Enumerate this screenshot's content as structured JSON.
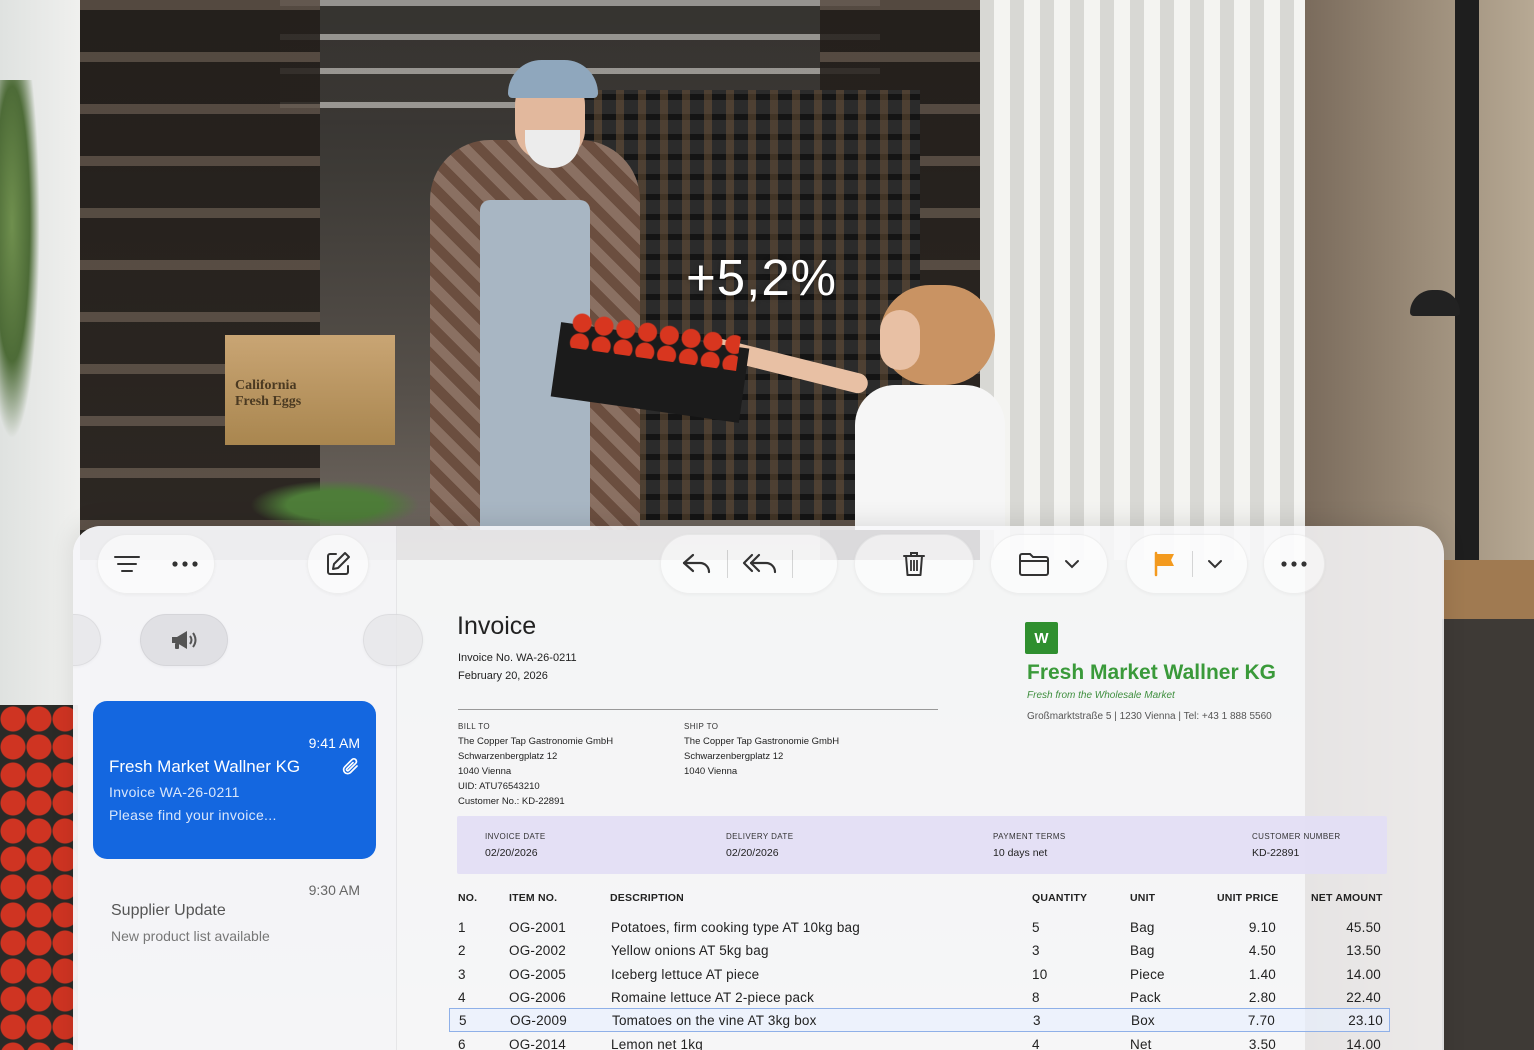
{
  "overlay": {
    "percent": "+5,2%"
  },
  "photo": {
    "box_text_1": "California",
    "box_text_2": "Fresh Eggs"
  },
  "sidebar": {
    "icons": [
      "menu-lines-icon",
      "ellipsis-icon",
      "compose-icon",
      "megaphone-icon"
    ],
    "messages": [
      {
        "time": "9:41 AM",
        "sender": "Fresh Market Wallner KG",
        "subject": "Invoice WA-26-0211",
        "preview": "Please find your invoice...",
        "selected": true
      },
      {
        "time": "9:30 AM",
        "sender": "Supplier Update",
        "preview": "New product list available",
        "selected": false
      }
    ]
  },
  "toolbar": {
    "icons": [
      "reply-icon",
      "reply-all-icon",
      "trash-icon",
      "folder-icon",
      "chevron-down-icon",
      "flag-icon",
      "chevron-down-icon",
      "ellipsis-icon"
    ],
    "flag_color": "#f39a1e"
  },
  "invoice": {
    "title": "Invoice",
    "number": "Invoice No. WA-26-0211",
    "date": "February 20, 2026",
    "bill_to": {
      "caption": "BILL TO",
      "name": "The Copper Tap Gastronomie GmbH",
      "street": "Schwarzenbergplatz 12",
      "city": "1040 Vienna",
      "uid": "UID: ATU76543210",
      "customer_no": "Customer No.: KD-22891"
    },
    "ship_to": {
      "caption": "SHIP TO",
      "name": "The Copper Tap Gastronomie GmbH",
      "street": "Schwarzenbergplatz 12",
      "city": "1040 Vienna"
    },
    "vendor": {
      "logo_letter": "W",
      "name": "Fresh Market Wallner KG",
      "tagline": "Fresh from the Wholesale Market",
      "address": "Großmarktstraße 5 | 1230 Vienna | Tel: +43 1 888 5560",
      "color": "#3a9a3a"
    },
    "meta": {
      "invoice_date_label": "INVOICE DATE",
      "invoice_date": "02/20/2026",
      "delivery_date_label": "DELIVERY  DATE",
      "delivery_date": "02/20/2026",
      "payment_terms_label": "PAYMENT TERMS",
      "payment_terms": "10 days net",
      "customer_number_label": "CUSTOMER NUMBER",
      "customer_number": "KD-22891"
    },
    "columns": {
      "no": "NO.",
      "item": "ITEM NO.",
      "desc": "DESCRIPTION",
      "qty": "QUANTITY",
      "unit": "UNIT",
      "price": "UNIT PRICE",
      "net": "NET AMOUNT"
    },
    "rows": [
      {
        "no": "1",
        "item": "OG-2001",
        "desc": "Potatoes, firm cooking type AT 10kg bag",
        "qty": "5",
        "unit": "Bag",
        "price": "9.10",
        "net": "45.50"
      },
      {
        "no": "2",
        "item": "OG-2002",
        "desc": "Yellow onions AT 5kg bag",
        "qty": "3",
        "unit": "Bag",
        "price": "4.50",
        "net": "13.50"
      },
      {
        "no": "3",
        "item": "OG-2005",
        "desc": "Iceberg lettuce AT piece",
        "qty": "10",
        "unit": "Piece",
        "price": "1.40",
        "net": "14.00"
      },
      {
        "no": "4",
        "item": "OG-2006",
        "desc": "Romaine lettuce AT 2-piece pack",
        "qty": "8",
        "unit": "Pack",
        "price": "2.80",
        "net": "22.40"
      },
      {
        "no": "5",
        "item": "OG-2009",
        "desc": "Tomatoes on the vine AT 3kg box",
        "qty": "3",
        "unit": "Box",
        "price": "7.70",
        "net": "23.10"
      },
      {
        "no": "6",
        "item": "OG-2014",
        "desc": "Lemon net 1kg",
        "qty": "4",
        "unit": "Net",
        "price": "3.50",
        "net": "14.00"
      }
    ]
  }
}
